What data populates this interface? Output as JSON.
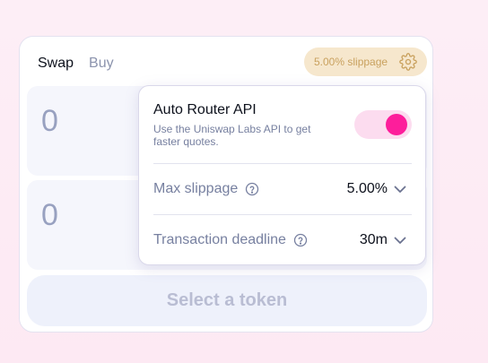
{
  "tabs": [
    {
      "label": "Swap",
      "active": true
    },
    {
      "label": "Buy",
      "active": false
    }
  ],
  "slippage_pill": {
    "label": "5.00% slippage",
    "icon": "gear-icon"
  },
  "inputs": {
    "top_amount": "0",
    "bottom_amount": "0"
  },
  "select_token_label": "Select a token",
  "settings": {
    "router": {
      "title": "Auto Router API",
      "description": "Use the Uniswap Labs API to get faster quotes.",
      "enabled": true
    },
    "max_slippage": {
      "label": "Max slippage",
      "value": "5.00%"
    },
    "deadline": {
      "label": "Transaction deadline",
      "value": "30m"
    }
  },
  "colors": {
    "accent_pink": "#fd1e9b",
    "toggle_track": "#fcdcef",
    "slippage_pill_bg": "#f6e7cd",
    "slippage_pill_text": "#c9a15e"
  }
}
